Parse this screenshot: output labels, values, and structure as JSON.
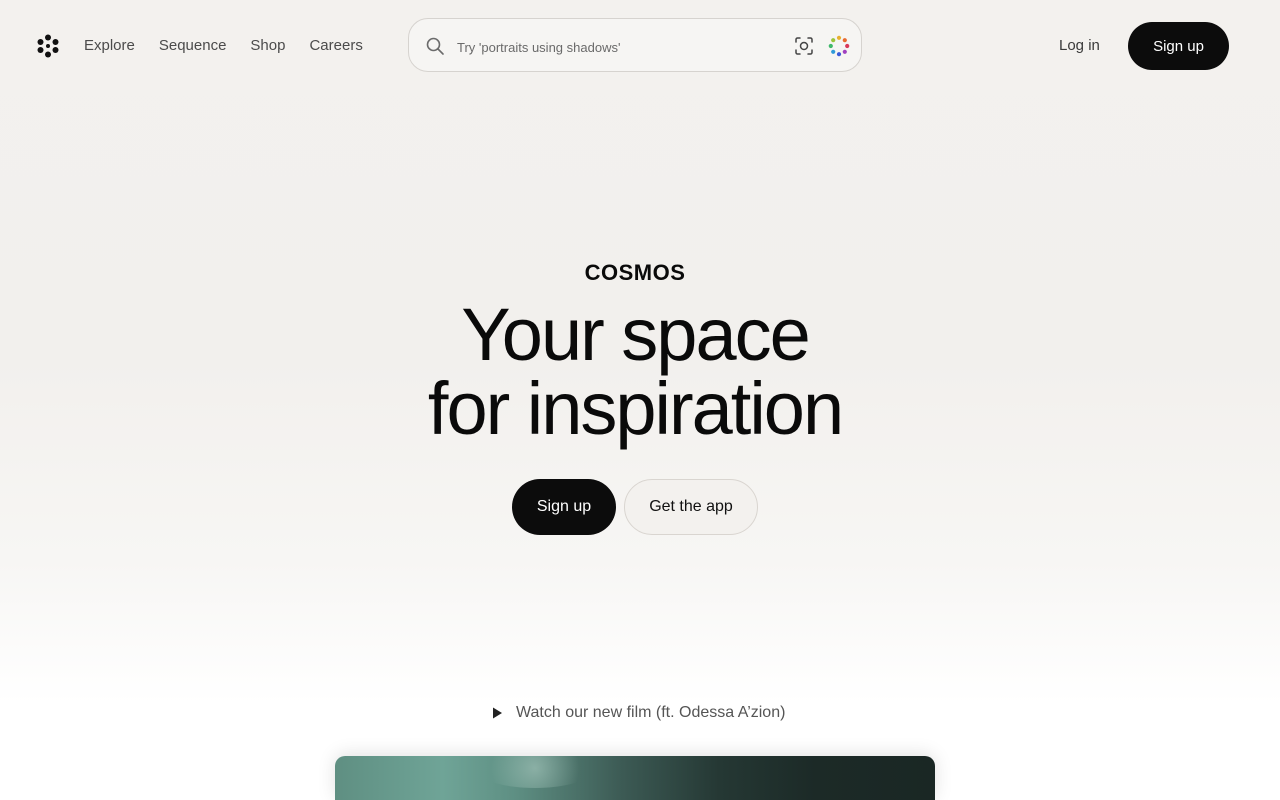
{
  "header": {
    "nav": [
      {
        "label": "Explore"
      },
      {
        "label": "Sequence"
      },
      {
        "label": "Shop"
      },
      {
        "label": "Careers"
      }
    ],
    "search": {
      "placeholder": "Try 'portraits using shadows'"
    },
    "login_label": "Log in",
    "signup_label": "Sign up"
  },
  "hero": {
    "brand": "COSMOS",
    "headline_line1": "Your space",
    "headline_line2": "for inspiration",
    "primary_cta": "Sign up",
    "secondary_cta": "Get the app"
  },
  "film": {
    "link_label": "Watch our new film (ft. Odessa A’zion)"
  },
  "colors": {
    "accent": "#0c0c0c",
    "background": "#f3f1ee"
  },
  "icons": {
    "logo": "dots-logo-icon",
    "search": "search-icon",
    "visual_search": "camera-lens-icon",
    "color_search": "color-palette-icon",
    "play": "play-icon"
  }
}
